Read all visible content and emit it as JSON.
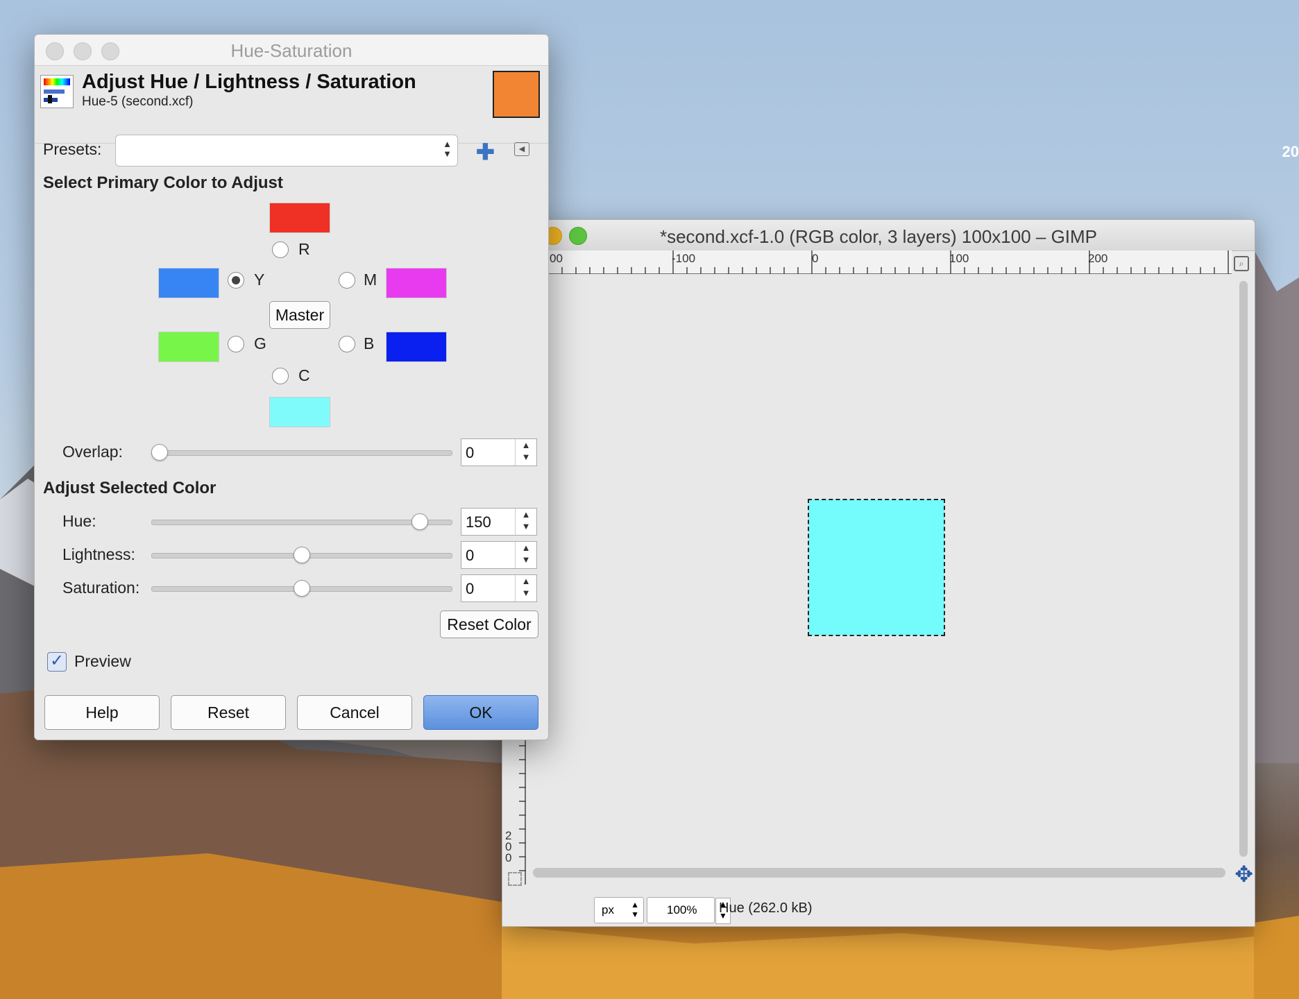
{
  "desktop": {
    "edge_text": "20"
  },
  "image_window": {
    "title": "*second.xcf-1.0 (RGB color, 3 layers) 100x100 – GIMP",
    "ruler_labels": [
      "00",
      "-100",
      "0",
      "100",
      "200"
    ],
    "vertical_ruler_label": "200",
    "layer_color": "#74fbfb",
    "status": {
      "unit": "px",
      "zoom": "100%",
      "message": "Hue (262.0 kB)"
    }
  },
  "dialog": {
    "window_title": "Hue-Saturation",
    "header_title": "Adjust Hue / Lightness / Saturation",
    "header_subtitle": "Hue-5 (second.xcf)",
    "header_swatch_color": "#f18533",
    "presets_label": "Presets:",
    "presets_value": "",
    "primary_section": "Select Primary Color to Adjust",
    "primaries": {
      "R": {
        "label": "R",
        "color": "#ef3024",
        "selected": false
      },
      "Y": {
        "label": "Y",
        "color": "#3785f5",
        "selected": true
      },
      "M": {
        "label": "M",
        "color": "#e83bef",
        "selected": false
      },
      "G": {
        "label": "G",
        "color": "#77f549",
        "selected": false
      },
      "B": {
        "label": "B",
        "color": "#0920f0",
        "selected": false
      },
      "C": {
        "label": "C",
        "color": "#7ffbfc",
        "selected": false
      }
    },
    "master_label": "Master",
    "overlap_label": "Overlap:",
    "overlap_value": "0",
    "adjust_section": "Adjust Selected Color",
    "hue_label": "Hue:",
    "hue_value": "150",
    "lightness_label": "Lightness:",
    "lightness_value": "0",
    "saturation_label": "Saturation:",
    "saturation_value": "0",
    "reset_color_label": "Reset Color",
    "preview_label": "Preview",
    "preview_checked": true,
    "buttons": {
      "help": "Help",
      "reset": "Reset",
      "cancel": "Cancel",
      "ok": "OK"
    }
  }
}
